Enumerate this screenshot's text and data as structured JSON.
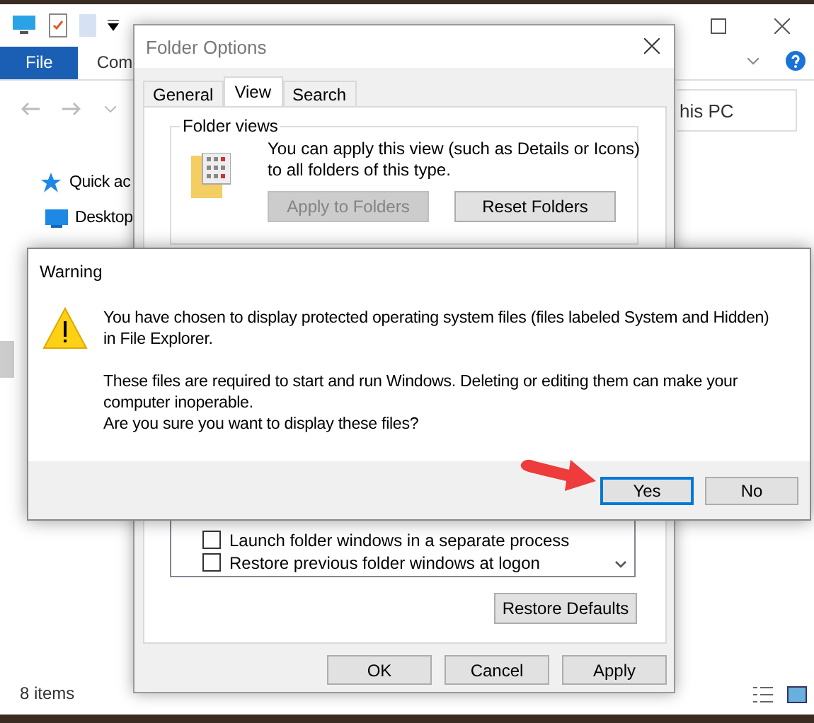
{
  "explorer": {
    "ribbon_tabs": [
      {
        "label": "File",
        "kind": "file"
      },
      {
        "label": "Com",
        "kind": "tab"
      }
    ],
    "address": "his PC",
    "nav_items": [
      {
        "label": "Quick ac",
        "kind": "star"
      },
      {
        "label": "Desktop",
        "kind": "desktop"
      }
    ],
    "status": "8 items"
  },
  "folder_options": {
    "title": "Folder Options",
    "tabs": [
      {
        "label": "General",
        "selected": false
      },
      {
        "label": "View",
        "selected": true
      },
      {
        "label": "Search",
        "selected": false
      }
    ],
    "group_title": "Folder views",
    "description": "You can apply this view (such as Details or Icons) to all folders of this type.",
    "buttons": [
      {
        "label": "Apply to Folders",
        "disabled": true
      },
      {
        "label": "Reset Folders",
        "disabled": false
      }
    ],
    "settings": [
      {
        "label": "Launch folder windows in a separate process",
        "checked": false
      },
      {
        "label": "Restore previous folder windows at logon",
        "checked": false
      }
    ],
    "restore_button": "Restore Defaults",
    "footer_buttons": [
      "OK",
      "Cancel",
      "Apply"
    ]
  },
  "warning": {
    "title": "Warning",
    "paragraphs": [
      "You have chosen to display protected operating system files (files labeled System and Hidden) in File Explorer.",
      "These files are required to start and run Windows. Deleting or editing them can make your computer inoperable.",
      "Are you sure you want to display these files?"
    ],
    "buttons": [
      {
        "label": "Yes",
        "selected": true
      },
      {
        "label": "No",
        "selected": false
      }
    ]
  }
}
